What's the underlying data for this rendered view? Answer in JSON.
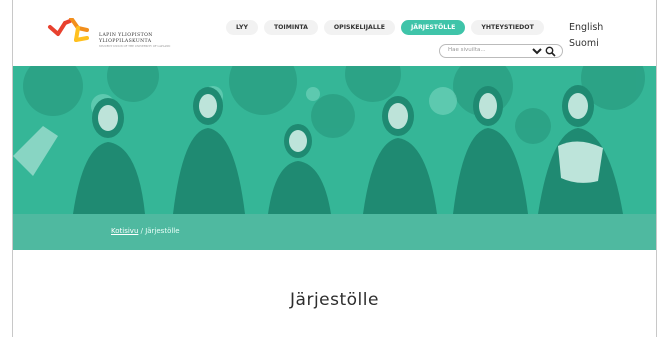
{
  "logo": {
    "line1": "LAPIN YLIOPISTON",
    "line2": "YLIOPPILASKUNTA",
    "tagline": "STUDENT UNION OF THE UNIVERSITY OF LAPLAND",
    "colors": [
      "#e8412e",
      "#f28f1c",
      "#ffc01f"
    ]
  },
  "nav": {
    "items": [
      {
        "label": "LYY"
      },
      {
        "label": "TOIMINTA"
      },
      {
        "label": "OPISKELIJALLE"
      },
      {
        "label": "JÄRJESTÖLLE",
        "active": true
      },
      {
        "label": "YHTEYSTIEDOT"
      }
    ]
  },
  "search": {
    "placeholder": "Hae sivuilta..."
  },
  "languages": {
    "english": "English",
    "finnish": "Suomi"
  },
  "breadcrumb": {
    "home": "Kotisivu",
    "separator": " / ",
    "current": "Järjestölle"
  },
  "page": {
    "title": "Järjestölle"
  },
  "colors": {
    "accent": "#3fc4a9",
    "hero": "#34b496",
    "breadcrumb_bar": "#4fb9a0"
  }
}
